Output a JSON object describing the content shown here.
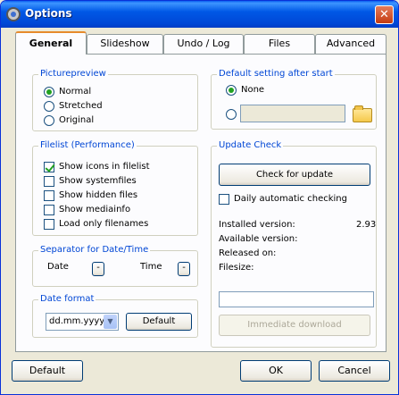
{
  "window": {
    "title": "Options",
    "close_glyph": "✕"
  },
  "tabs": [
    {
      "label": "General",
      "active": true
    },
    {
      "label": "Slideshow",
      "active": false
    },
    {
      "label": "Undo / Log",
      "active": false
    },
    {
      "label": "Files",
      "active": false
    },
    {
      "label": "Advanced",
      "active": false
    }
  ],
  "picturepreview": {
    "title": "Picturepreview",
    "options": [
      {
        "label": "Normal",
        "checked": true
      },
      {
        "label": "Stretched",
        "checked": false
      },
      {
        "label": "Original",
        "checked": false
      }
    ]
  },
  "filelist": {
    "title": "Filelist (Performance)",
    "items": [
      {
        "label": "Show icons in filelist",
        "checked": true
      },
      {
        "label": "Show systemfiles",
        "checked": false
      },
      {
        "label": "Show hidden files",
        "checked": false
      },
      {
        "label": "Show mediainfo",
        "checked": false
      },
      {
        "label": "Load only filenames",
        "checked": false
      }
    ]
  },
  "separator": {
    "title": "Separator for Date/Time",
    "date_label": "Date",
    "date_value": "-",
    "time_label": "Time",
    "time_value": "-"
  },
  "date_format": {
    "title": "Date format",
    "selected": "dd.mm.yyyy",
    "default_button": "Default"
  },
  "default_setting": {
    "title": "Default setting after start",
    "none_label": "None",
    "none_checked": true,
    "path_value": "",
    "folder_icon": "folder-icon"
  },
  "update_check": {
    "title": "Update Check",
    "check_button": "Check for update",
    "daily_label": "Daily automatic checking",
    "daily_checked": false,
    "installed_label": "Installed version:",
    "installed_value": "2.93",
    "available_label": "Available version:",
    "released_label": "Released on:",
    "filesize_label": "Filesize:",
    "download_value": "",
    "download_button": "Immediate download"
  },
  "footer": {
    "default_button": "Default",
    "ok_button": "OK",
    "cancel_button": "Cancel"
  }
}
